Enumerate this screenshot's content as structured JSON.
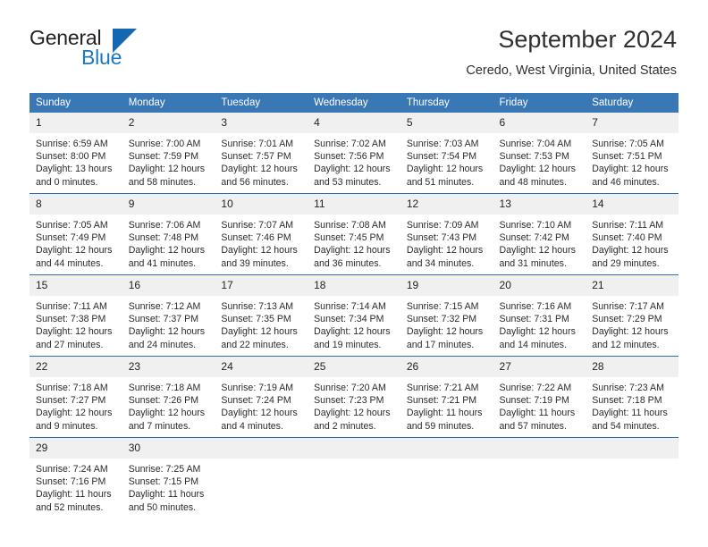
{
  "brand": {
    "name_part1": "General",
    "name_part2": "Blue",
    "accent_color": "#1567b2"
  },
  "header": {
    "title": "September 2024",
    "subtitle": "Ceredo, West Virginia, United States"
  },
  "theme": {
    "header_row_bg": "#3a78b5",
    "row_divider": "#2f6ca8",
    "daynum_bg": "#f0f0f0"
  },
  "weekdays": [
    "Sunday",
    "Monday",
    "Tuesday",
    "Wednesday",
    "Thursday",
    "Friday",
    "Saturday"
  ],
  "weeks": [
    [
      {
        "day": "1",
        "sunrise": "Sunrise: 6:59 AM",
        "sunset": "Sunset: 8:00 PM",
        "daylight1": "Daylight: 13 hours",
        "daylight2": "and 0 minutes."
      },
      {
        "day": "2",
        "sunrise": "Sunrise: 7:00 AM",
        "sunset": "Sunset: 7:59 PM",
        "daylight1": "Daylight: 12 hours",
        "daylight2": "and 58 minutes."
      },
      {
        "day": "3",
        "sunrise": "Sunrise: 7:01 AM",
        "sunset": "Sunset: 7:57 PM",
        "daylight1": "Daylight: 12 hours",
        "daylight2": "and 56 minutes."
      },
      {
        "day": "4",
        "sunrise": "Sunrise: 7:02 AM",
        "sunset": "Sunset: 7:56 PM",
        "daylight1": "Daylight: 12 hours",
        "daylight2": "and 53 minutes."
      },
      {
        "day": "5",
        "sunrise": "Sunrise: 7:03 AM",
        "sunset": "Sunset: 7:54 PM",
        "daylight1": "Daylight: 12 hours",
        "daylight2": "and 51 minutes."
      },
      {
        "day": "6",
        "sunrise": "Sunrise: 7:04 AM",
        "sunset": "Sunset: 7:53 PM",
        "daylight1": "Daylight: 12 hours",
        "daylight2": "and 48 minutes."
      },
      {
        "day": "7",
        "sunrise": "Sunrise: 7:05 AM",
        "sunset": "Sunset: 7:51 PM",
        "daylight1": "Daylight: 12 hours",
        "daylight2": "and 46 minutes."
      }
    ],
    [
      {
        "day": "8",
        "sunrise": "Sunrise: 7:05 AM",
        "sunset": "Sunset: 7:49 PM",
        "daylight1": "Daylight: 12 hours",
        "daylight2": "and 44 minutes."
      },
      {
        "day": "9",
        "sunrise": "Sunrise: 7:06 AM",
        "sunset": "Sunset: 7:48 PM",
        "daylight1": "Daylight: 12 hours",
        "daylight2": "and 41 minutes."
      },
      {
        "day": "10",
        "sunrise": "Sunrise: 7:07 AM",
        "sunset": "Sunset: 7:46 PM",
        "daylight1": "Daylight: 12 hours",
        "daylight2": "and 39 minutes."
      },
      {
        "day": "11",
        "sunrise": "Sunrise: 7:08 AM",
        "sunset": "Sunset: 7:45 PM",
        "daylight1": "Daylight: 12 hours",
        "daylight2": "and 36 minutes."
      },
      {
        "day": "12",
        "sunrise": "Sunrise: 7:09 AM",
        "sunset": "Sunset: 7:43 PM",
        "daylight1": "Daylight: 12 hours",
        "daylight2": "and 34 minutes."
      },
      {
        "day": "13",
        "sunrise": "Sunrise: 7:10 AM",
        "sunset": "Sunset: 7:42 PM",
        "daylight1": "Daylight: 12 hours",
        "daylight2": "and 31 minutes."
      },
      {
        "day": "14",
        "sunrise": "Sunrise: 7:11 AM",
        "sunset": "Sunset: 7:40 PM",
        "daylight1": "Daylight: 12 hours",
        "daylight2": "and 29 minutes."
      }
    ],
    [
      {
        "day": "15",
        "sunrise": "Sunrise: 7:11 AM",
        "sunset": "Sunset: 7:38 PM",
        "daylight1": "Daylight: 12 hours",
        "daylight2": "and 27 minutes."
      },
      {
        "day": "16",
        "sunrise": "Sunrise: 7:12 AM",
        "sunset": "Sunset: 7:37 PM",
        "daylight1": "Daylight: 12 hours",
        "daylight2": "and 24 minutes."
      },
      {
        "day": "17",
        "sunrise": "Sunrise: 7:13 AM",
        "sunset": "Sunset: 7:35 PM",
        "daylight1": "Daylight: 12 hours",
        "daylight2": "and 22 minutes."
      },
      {
        "day": "18",
        "sunrise": "Sunrise: 7:14 AM",
        "sunset": "Sunset: 7:34 PM",
        "daylight1": "Daylight: 12 hours",
        "daylight2": "and 19 minutes."
      },
      {
        "day": "19",
        "sunrise": "Sunrise: 7:15 AM",
        "sunset": "Sunset: 7:32 PM",
        "daylight1": "Daylight: 12 hours",
        "daylight2": "and 17 minutes."
      },
      {
        "day": "20",
        "sunrise": "Sunrise: 7:16 AM",
        "sunset": "Sunset: 7:31 PM",
        "daylight1": "Daylight: 12 hours",
        "daylight2": "and 14 minutes."
      },
      {
        "day": "21",
        "sunrise": "Sunrise: 7:17 AM",
        "sunset": "Sunset: 7:29 PM",
        "daylight1": "Daylight: 12 hours",
        "daylight2": "and 12 minutes."
      }
    ],
    [
      {
        "day": "22",
        "sunrise": "Sunrise: 7:18 AM",
        "sunset": "Sunset: 7:27 PM",
        "daylight1": "Daylight: 12 hours",
        "daylight2": "and 9 minutes."
      },
      {
        "day": "23",
        "sunrise": "Sunrise: 7:18 AM",
        "sunset": "Sunset: 7:26 PM",
        "daylight1": "Daylight: 12 hours",
        "daylight2": "and 7 minutes."
      },
      {
        "day": "24",
        "sunrise": "Sunrise: 7:19 AM",
        "sunset": "Sunset: 7:24 PM",
        "daylight1": "Daylight: 12 hours",
        "daylight2": "and 4 minutes."
      },
      {
        "day": "25",
        "sunrise": "Sunrise: 7:20 AM",
        "sunset": "Sunset: 7:23 PM",
        "daylight1": "Daylight: 12 hours",
        "daylight2": "and 2 minutes."
      },
      {
        "day": "26",
        "sunrise": "Sunrise: 7:21 AM",
        "sunset": "Sunset: 7:21 PM",
        "daylight1": "Daylight: 11 hours",
        "daylight2": "and 59 minutes."
      },
      {
        "day": "27",
        "sunrise": "Sunrise: 7:22 AM",
        "sunset": "Sunset: 7:19 PM",
        "daylight1": "Daylight: 11 hours",
        "daylight2": "and 57 minutes."
      },
      {
        "day": "28",
        "sunrise": "Sunrise: 7:23 AM",
        "sunset": "Sunset: 7:18 PM",
        "daylight1": "Daylight: 11 hours",
        "daylight2": "and 54 minutes."
      }
    ],
    [
      {
        "day": "29",
        "sunrise": "Sunrise: 7:24 AM",
        "sunset": "Sunset: 7:16 PM",
        "daylight1": "Daylight: 11 hours",
        "daylight2": "and 52 minutes."
      },
      {
        "day": "30",
        "sunrise": "Sunrise: 7:25 AM",
        "sunset": "Sunset: 7:15 PM",
        "daylight1": "Daylight: 11 hours",
        "daylight2": "and 50 minutes."
      },
      {
        "day": "",
        "sunrise": "",
        "sunset": "",
        "daylight1": "",
        "daylight2": ""
      },
      {
        "day": "",
        "sunrise": "",
        "sunset": "",
        "daylight1": "",
        "daylight2": ""
      },
      {
        "day": "",
        "sunrise": "",
        "sunset": "",
        "daylight1": "",
        "daylight2": ""
      },
      {
        "day": "",
        "sunrise": "",
        "sunset": "",
        "daylight1": "",
        "daylight2": ""
      },
      {
        "day": "",
        "sunrise": "",
        "sunset": "",
        "daylight1": "",
        "daylight2": ""
      }
    ]
  ]
}
